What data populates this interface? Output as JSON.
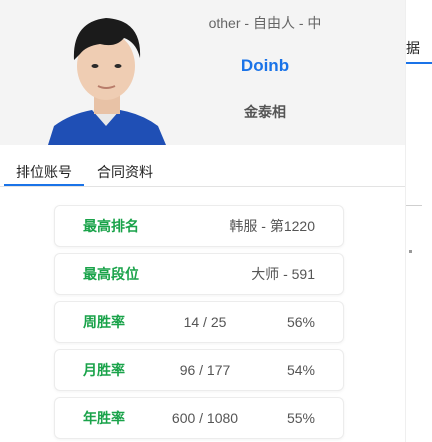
{
  "player": {
    "meta": "other - 自由人 - 中",
    "name": "Doinb",
    "real_name": "金泰相"
  },
  "tabs": {
    "ranked": "排位账号",
    "contract": "合同资料"
  },
  "stats": {
    "peak_rank": {
      "label": "最高排名",
      "value": "韩服 - 第1220"
    },
    "peak_tier": {
      "label": "最高段位",
      "value": "大师 - 591"
    },
    "weekly": {
      "label": "周胜率",
      "record": "14 / 25",
      "rate": "56%"
    },
    "monthly": {
      "label": "月胜率",
      "record": "96 / 177",
      "rate": "54%"
    },
    "yearly": {
      "label": "年胜率",
      "record": "600 / 1080",
      "rate": "55%"
    }
  },
  "background_page": {
    "tab_fragment": "据"
  },
  "colors": {
    "accent_blue": "#1a73e8",
    "label_green": "#1aa34a",
    "header_bg": "#f4f4f4"
  }
}
